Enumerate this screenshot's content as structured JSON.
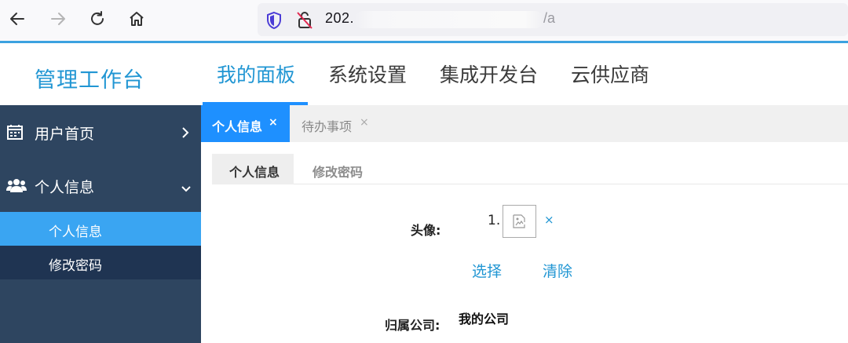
{
  "browser": {
    "url_visible_prefix": "202.",
    "url_visible_suffix": "/a"
  },
  "header": {
    "brand": "管理工作台",
    "nav": [
      "我的面板",
      "系统设置",
      "集成开发台",
      "云供应商"
    ],
    "active_nav_index": 0
  },
  "sidebar": {
    "items": [
      {
        "label": "用户首页",
        "icon": "calendar-icon",
        "expanded": false
      },
      {
        "label": "个人信息",
        "icon": "users-icon",
        "expanded": true
      }
    ],
    "subitems": [
      {
        "label": "个人信息",
        "active": true
      },
      {
        "label": "修改密码",
        "active": false
      }
    ]
  },
  "tabs": [
    {
      "label": "个人信息",
      "close": "×",
      "active": true
    },
    {
      "label": "待办事项",
      "close": "×",
      "active": false
    }
  ],
  "subtabs": [
    {
      "label": "个人信息",
      "active": true
    },
    {
      "label": "修改密码",
      "active": false
    }
  ],
  "form": {
    "avatar_label": "头像:",
    "avatar_index": "1.",
    "avatar_remove": "×",
    "select_label": "选择",
    "clear_label": "清除",
    "company_label": "归属公司:",
    "company_value": "我的公司"
  },
  "colors": {
    "accent": "#1e90ff",
    "brand_text": "#2196d3",
    "sidebar_bg": "#2e4560",
    "sidebar_active": "#3aa5f2",
    "sidebar_sub_bg": "#1f3452"
  }
}
